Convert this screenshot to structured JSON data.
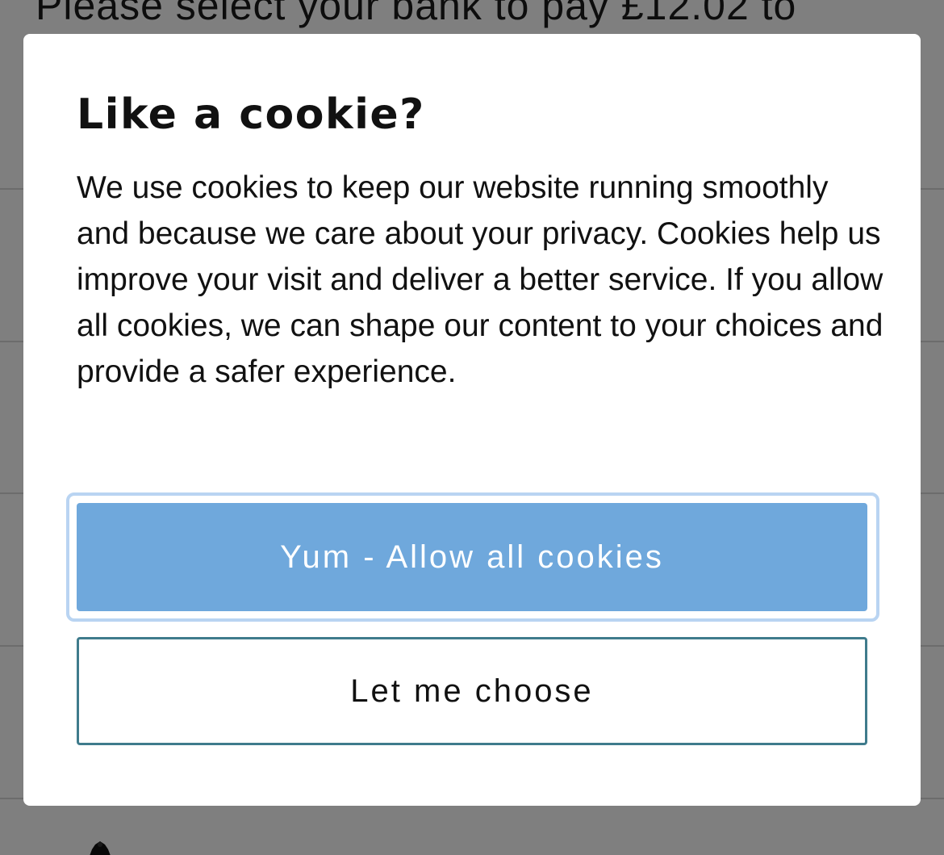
{
  "background": {
    "heading": "Please select your bank to pay £12.02 to"
  },
  "cookie_modal": {
    "title": "Like a cookie?",
    "body": "We use cookies to keep our website running smoothly and because we care about your privacy. Cookies help us improve your visit and deliver a better service. If you allow all cookies, we can shape our content to your choices and provide a safer experience.",
    "allow_all_label": "Yum - Allow all cookies",
    "choose_label": "Let me choose"
  },
  "colors": {
    "primary_button": "#6fa8dc",
    "secondary_border": "#3f7b8c",
    "focus_ring": "#b9d4f2",
    "overlay": "rgba(0,0,0,0.5)"
  }
}
